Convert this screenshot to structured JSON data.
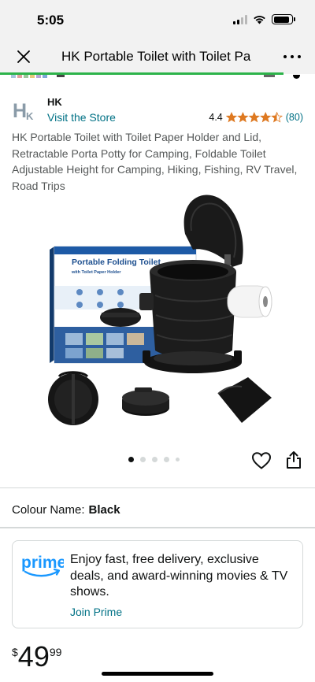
{
  "status_bar": {
    "time": "5:05"
  },
  "nav": {
    "title": "HK Portable Toilet with Toilet Pa"
  },
  "page_progress": 0.9,
  "brand": {
    "name": "HK",
    "visit_store": "Visit the Store",
    "logo_text": "HK"
  },
  "rating": {
    "value": "4.4",
    "stars": 4.5,
    "count": "(80)"
  },
  "product": {
    "title": "HK Portable Toilet with Toilet Paper Holder and Lid, Retractable Porta Potty for Camping, Foldable Toilet Adjustable Height for Camping, Hiking, Fishing, RV Travel, Road Trips",
    "box_title": "Portable Folding Toilet",
    "box_subtitle": "with Toilet Paper Holder"
  },
  "gallery": {
    "total_images": 5,
    "active_index": 0
  },
  "colour": {
    "label": "Colour Name:",
    "value": "Black"
  },
  "prime": {
    "logo_text": "prime",
    "message": "Enjoy fast, free delivery, exclusive deals, and award-winning movies & TV shows.",
    "join_label": "Join Prime"
  },
  "price": {
    "currency": "$",
    "whole": "49",
    "fraction": "99"
  },
  "colors": {
    "link": "#007185",
    "star": "#de7921",
    "prime_blue": "#1a98ff",
    "progress": "#2db34a"
  }
}
